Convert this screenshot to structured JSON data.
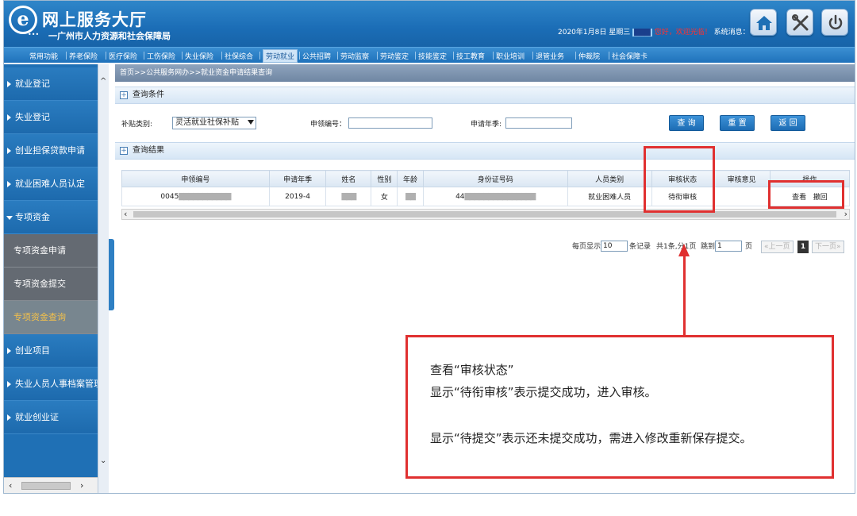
{
  "header": {
    "logo_letter": "e",
    "title": "网上服务大厅",
    "subtitle": "一广州市人力资源和社会保障局",
    "date": "2020年1月8日 星期三",
    "user_blur": "▇▇▇",
    "greeting": "您好，欢迎光临！",
    "sys_msg": "系统消息：0/0"
  },
  "nav": [
    {
      "label": "常用功能",
      "active": false
    },
    {
      "label": "养老保险",
      "active": false
    },
    {
      "label": "医疗保险",
      "active": false
    },
    {
      "label": "工伤保险",
      "active": false
    },
    {
      "label": "失业保险",
      "active": false
    },
    {
      "label": "社保综合",
      "active": false
    },
    {
      "label": "劳动就业",
      "active": true
    },
    {
      "label": "公共招聘",
      "active": false
    },
    {
      "label": "劳动监察",
      "active": false
    },
    {
      "label": "劳动鉴定",
      "active": false
    },
    {
      "label": "技能鉴定",
      "active": false
    },
    {
      "label": "技工教育",
      "active": false
    },
    {
      "label": "职业培训",
      "active": false
    },
    {
      "label": "退管业务",
      "active": false
    },
    {
      "label": "仲裁院",
      "active": false
    },
    {
      "label": "社会保障卡",
      "active": false
    }
  ],
  "sidebar": {
    "items": [
      {
        "label": "就业登记"
      },
      {
        "label": "失业登记"
      },
      {
        "label": "创业担保贷款申请"
      },
      {
        "label": "就业困难人员认定"
      },
      {
        "label": "专项资金"
      }
    ],
    "sub_items": [
      {
        "label": "专项资金申请"
      },
      {
        "label": "专项资金提交"
      },
      {
        "label": "专项资金查询"
      }
    ],
    "items_after": [
      {
        "label": "创业项目"
      },
      {
        "label": "失业人员人事档案管理"
      },
      {
        "label": "就业创业证"
      }
    ]
  },
  "breadcrumb": "首页>>公共服务网办>>就业资金申请结果查询",
  "query": {
    "section_title": "查询条件",
    "subsidy_label": "补贴类别:",
    "subsidy_value": "灵活就业社保补贴",
    "code_label": "申领编号：",
    "season_label": "申请年季:",
    "btn_query": "查 询",
    "btn_reset": "重 置",
    "btn_back": "返 回"
  },
  "results": {
    "section_title": "查询结果",
    "columns": [
      "申领编号",
      "申请年季",
      "姓名",
      "性别",
      "年龄",
      "身份证号码",
      "人员类别",
      "审核状态",
      "审核意见",
      "操作"
    ],
    "row": {
      "code": "0045",
      "code_blur": "▇▇▇▇▇▇▇▇▇▇▇",
      "season": "2019-4",
      "name_blur": "▇▇▇",
      "gender": "女",
      "age_blur": "▇▇",
      "id_prefix": "44",
      "id_blur": "▇▇▇▇▇▇▇▇▇▇▇▇▇▇▇",
      "category": "就业困难人员",
      "status": "待衔审核",
      "opinion": "",
      "action_view": "查看",
      "action_withdraw": "撤回"
    }
  },
  "pager": {
    "per_page_prefix": "每页显示",
    "per_page": "10",
    "per_page_suffix": "条记录",
    "total": "共1条,分1页",
    "goto_label": "跳到",
    "goto_value": "1",
    "page_suffix": "页",
    "prev": "«上一页",
    "current": "1",
    "next": "下一页»"
  },
  "callout": {
    "line1": "查看“审核状态”",
    "line2": "显示“待衔审核”表示提交成功，进入审核。",
    "line3": "显示“待提交”表示还未提交成功，需进入修改重新保存提交。"
  },
  "colors": {
    "brand_blue": "#1b6db6",
    "annotation_red": "#e03030",
    "active_sub": "#f4c14a"
  },
  "icons": [
    "home-icon",
    "tools-icon",
    "power-icon",
    "plus-icon",
    "chevron-down-icon"
  ]
}
